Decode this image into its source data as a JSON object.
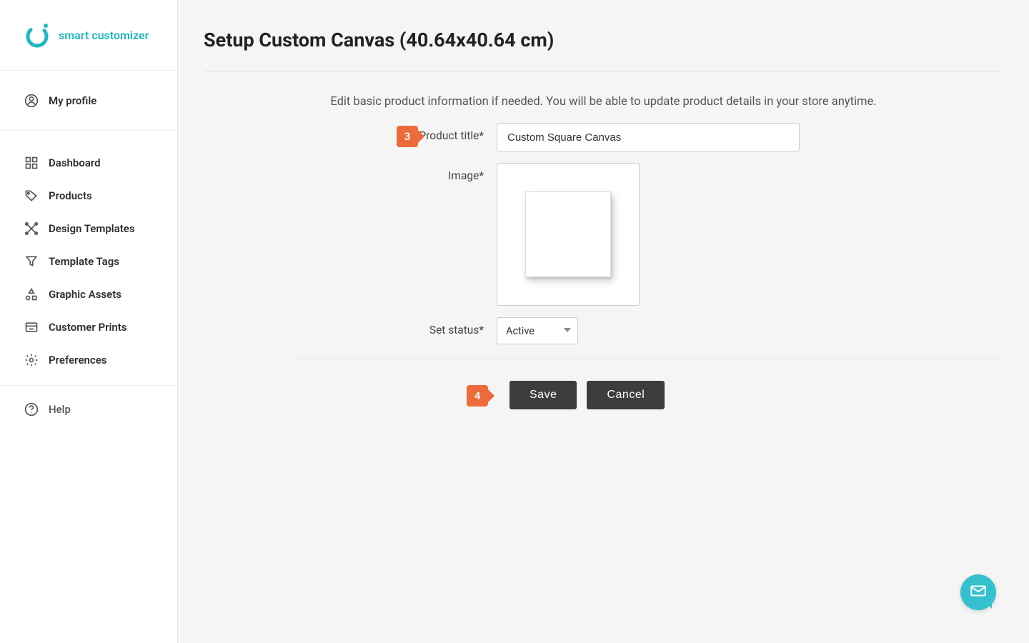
{
  "brand": {
    "name": "smart customizer"
  },
  "sidebar": {
    "profile_label": "My profile",
    "items": [
      {
        "label": "Dashboard"
      },
      {
        "label": "Products"
      },
      {
        "label": "Design Templates"
      },
      {
        "label": "Template Tags"
      },
      {
        "label": "Graphic Assets"
      },
      {
        "label": "Customer Prints"
      },
      {
        "label": "Preferences"
      }
    ],
    "help_label": "Help"
  },
  "page": {
    "title": "Setup Custom Canvas (40.64x40.64 cm)",
    "intro": "Edit basic product information if needed. You will be able to update product details in your store anytime."
  },
  "form": {
    "step3": "3",
    "product_title_label": "Product title*",
    "product_title_value": "Custom Square Canvas",
    "image_label": "Image*",
    "status_label": "Set status*",
    "status_value": "Active",
    "step4": "4",
    "save_label": "Save",
    "cancel_label": "Cancel"
  }
}
